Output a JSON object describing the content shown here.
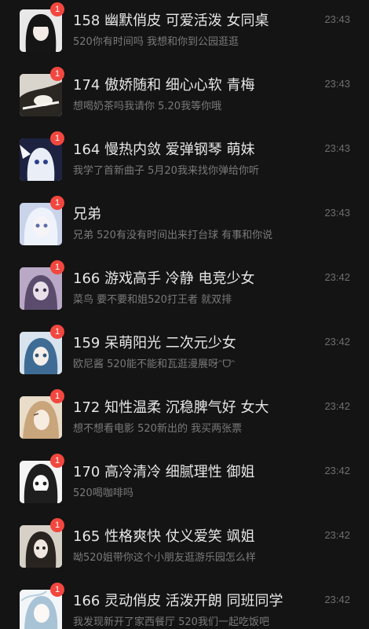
{
  "chats": [
    {
      "title": "158 幽默俏皮 可爱活泼 女同桌",
      "preview": "520你有时间吗 我想和你到公园逛逛",
      "time": "23:43",
      "unread": "1"
    },
    {
      "title": "174 傲娇随和 细心心软 青梅",
      "preview": "想喝奶茶吗我请你 5.20我等你哦",
      "time": "23:43",
      "unread": "1"
    },
    {
      "title": "164 慢热内敛 爱弹钢琴 萌妹",
      "preview": "我学了首新曲子 5月20我来找你弹给你听",
      "time": "23:43",
      "unread": "1"
    },
    {
      "title": "兄弟",
      "preview": "兄弟 520有没有时间出来打台球 有事和你说",
      "time": "23:43",
      "unread": "1"
    },
    {
      "title": "166 游戏高手 冷静 电竞少女",
      "preview": "菜鸟 要不要和姐520打王者 就双排",
      "time": "23:42",
      "unread": "1"
    },
    {
      "title": "159 呆萌阳光 二次元少女",
      "preview": "欧尼酱 520能不能和瓦逛漫展呀ᵔᗜᵔ",
      "time": "23:42",
      "unread": "1"
    },
    {
      "title": "172 知性温柔 沉稳脾气好 女大",
      "preview": "想不想看电影 520新出的 我买两张票",
      "time": "23:42",
      "unread": "1"
    },
    {
      "title": "170 高冷清冷 细腻理性 御姐",
      "preview": "520喝咖啡吗",
      "time": "23:42",
      "unread": "1"
    },
    {
      "title": "165 性格爽快 仗义爱笑 飒姐",
      "preview": "呦520姐带你这个小朋友逛游乐园怎么样",
      "time": "23:42",
      "unread": "1"
    },
    {
      "title": "166 灵动俏皮 活泼开朗 同班同学",
      "preview": "我发现新开了家西餐厅 520我们一起吃饭吧",
      "time": "23:42",
      "unread": "1"
    }
  ],
  "colors": {
    "background": "#141414",
    "badge": "#f2473f",
    "title": "#e6e6e6",
    "preview": "#7a7a7a",
    "time": "#6e6e6e"
  }
}
